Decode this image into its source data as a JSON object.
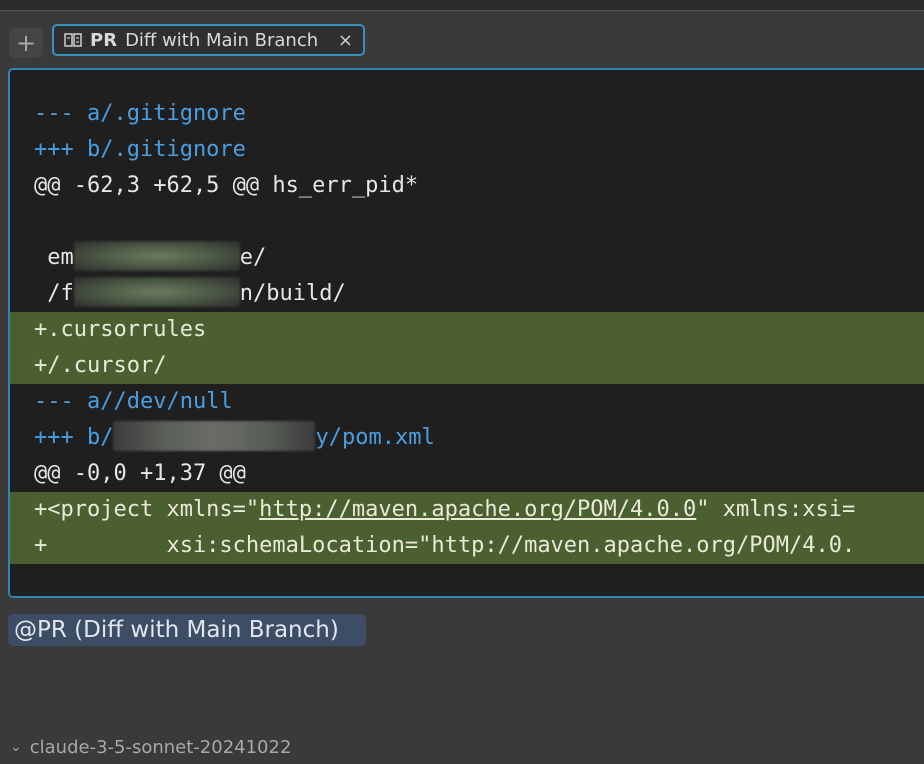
{
  "toolbar": {
    "add_label": "+",
    "tab": {
      "icon": "diff-icon",
      "pr_tag": "PR",
      "title": "Diff with Main Branch",
      "close_label": "×"
    }
  },
  "diff": {
    "lines": [
      {
        "type": "meta",
        "text": "--- a/.gitignore"
      },
      {
        "type": "meta",
        "text": "+++ b/.gitignore"
      },
      {
        "type": "hunk",
        "text": "@@ -62,3 +62,5 @@ hs_err_pid*"
      },
      {
        "type": "blank",
        "text": " "
      },
      {
        "type": "context",
        "prefix": " em",
        "suffix": "e/"
      },
      {
        "type": "context",
        "prefix": " /f",
        "suffix": "n/build/"
      },
      {
        "type": "added",
        "text": "+.cursorrules"
      },
      {
        "type": "added",
        "text": "+/.cursor/"
      },
      {
        "type": "meta",
        "text": "--- a//dev/null"
      },
      {
        "type": "meta",
        "prefix": "+++ b/",
        "suffix": "y/pom.xml"
      },
      {
        "type": "hunk",
        "text": "@@ -0,0 +1,37 @@"
      },
      {
        "type": "added",
        "before": "+<project xmlns=\"",
        "url": "http://maven.apache.org/POM/4.0.0",
        "after": "\" xmlns:xsi="
      },
      {
        "type": "added",
        "text": "+         xsi:schemaLocation=\"http://maven.apache.org/POM/4.0."
      }
    ]
  },
  "mention": {
    "label": "@PR (Diff with Main Branch)"
  },
  "model": {
    "label": "claude-3-5-sonnet-20241022",
    "chevron": "⌄"
  }
}
